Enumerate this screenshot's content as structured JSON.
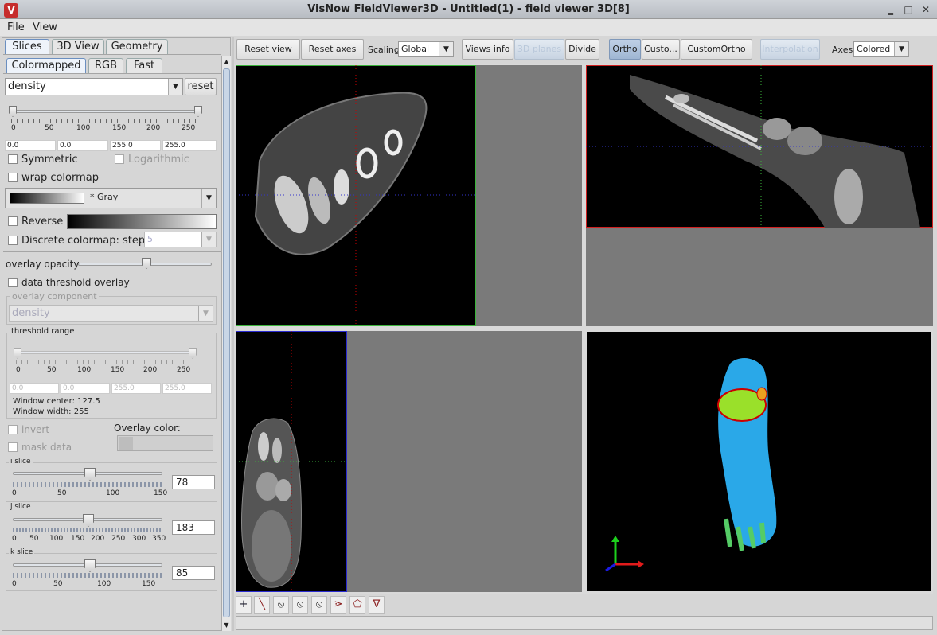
{
  "window": {
    "title": "VisNow FieldViewer3D - Untitled(1) - field viewer 3D[8]",
    "logo": "V"
  },
  "menu": [
    "File",
    "View"
  ],
  "panel_tabs": [
    "Slices",
    "3D View",
    "Geometry"
  ],
  "sub_tabs": [
    "Colormapped",
    "RGB",
    "Fast"
  ],
  "component": {
    "value": "density",
    "reset_label": "reset"
  },
  "range_scale": [
    "0",
    "50",
    "100",
    "150",
    "200",
    "250"
  ],
  "range_fields": [
    "0.0",
    "0.0",
    "255.0",
    "255.0"
  ],
  "options": {
    "symmetric": "Symmetric",
    "logarithmic": "Logarithmic",
    "wrap": "wrap colormap",
    "colormap": "* Gray",
    "reverse": "Reverse",
    "discrete": "Discrete colormap: step",
    "step": "5"
  },
  "overlay": {
    "opacity_label": "overlay opacity",
    "threshold_overlay": "data threshold overlay",
    "component_label": "overlay component",
    "component_value": "density",
    "threshold_range": "threshold range",
    "threshold_fields": [
      "0.0",
      "0.0",
      "255.0",
      "255.0"
    ],
    "window_center": "Window center: 127.5",
    "window_width": "Window width:  255",
    "invert": "invert",
    "mask": "mask data",
    "color_label": "Overlay color:"
  },
  "slices": [
    {
      "label": "i slice",
      "value": "78",
      "ticks": [
        "0",
        "50",
        "100",
        "150"
      ]
    },
    {
      "label": "j slice",
      "value": "183",
      "ticks": [
        "0",
        "50",
        "100",
        "150",
        "200",
        "250",
        "300",
        "350"
      ]
    },
    {
      "label": "k slice",
      "value": "85",
      "ticks": [
        "0",
        "50",
        "100",
        "150"
      ]
    }
  ],
  "toolbar": {
    "reset_view": "Reset view",
    "reset_axes": "Reset axes",
    "scaling_label": "Scaling:",
    "scaling_value": "Global",
    "views_info": "Views info",
    "planes": "3D planes",
    "divide": "Divide",
    "ortho": "Ortho",
    "custom": "Custo...",
    "custom_ortho": "CustomOrtho",
    "interpolation": "Interpolation",
    "axes_label": "Axes:",
    "axes_value": "Colored"
  },
  "colors": {
    "accent": "#6b8fc0",
    "view_green": "#3bb33b",
    "view_red": "#d02020",
    "view_blue": "#2a2ad0"
  }
}
